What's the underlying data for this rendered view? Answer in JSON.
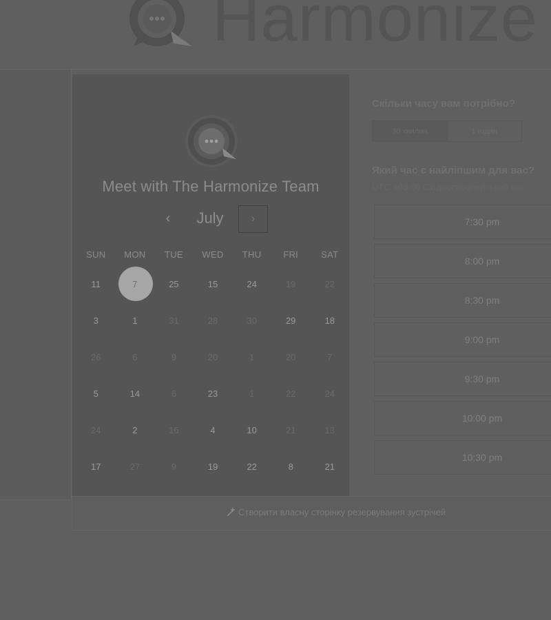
{
  "brand": {
    "name": "Harmonize",
    "logo_icon": "chat-bubble-q-logo"
  },
  "calendar": {
    "title": "Meet with The Harmonize Team",
    "month": "July",
    "prev_icon": "chevron-left-icon",
    "next_icon": "chevron-right-icon",
    "prev_glyph": "‹",
    "next_glyph": "›",
    "weekdays": [
      "SUN",
      "MON",
      "TUE",
      "WED",
      "THU",
      "FRI",
      "SAT"
    ],
    "weeks": [
      [
        {
          "label": "11",
          "available": true
        },
        {
          "label": "7",
          "available": true,
          "selected": true
        },
        {
          "label": "25",
          "available": true
        },
        {
          "label": "15",
          "available": true
        },
        {
          "label": "24",
          "available": true
        },
        {
          "label": "19",
          "available": false
        },
        {
          "label": "22",
          "available": false
        }
      ],
      [
        {
          "label": "3",
          "available": true
        },
        {
          "label": "1",
          "available": true
        },
        {
          "label": "31",
          "available": false
        },
        {
          "label": "28",
          "available": false
        },
        {
          "label": "30",
          "available": false
        },
        {
          "label": "29",
          "available": true
        },
        {
          "label": "18",
          "available": true
        }
      ],
      [
        {
          "label": "26",
          "available": false
        },
        {
          "label": "6",
          "available": false
        },
        {
          "label": "9",
          "available": false
        },
        {
          "label": "20",
          "available": false
        },
        {
          "label": "1",
          "available": false
        },
        {
          "label": "20",
          "available": false
        },
        {
          "label": "7",
          "available": false
        }
      ],
      [
        {
          "label": "5",
          "available": true
        },
        {
          "label": "14",
          "available": true
        },
        {
          "label": "6",
          "available": false
        },
        {
          "label": "23",
          "available": true
        },
        {
          "label": "1",
          "available": false
        },
        {
          "label": "22",
          "available": false
        },
        {
          "label": "24",
          "available": false
        }
      ],
      [
        {
          "label": "24",
          "available": false
        },
        {
          "label": "2",
          "available": true
        },
        {
          "label": "16",
          "available": false
        },
        {
          "label": "4",
          "available": true
        },
        {
          "label": "10",
          "available": true
        },
        {
          "label": "21",
          "available": false
        },
        {
          "label": "13",
          "available": false
        }
      ],
      [
        {
          "label": "17",
          "available": true
        },
        {
          "label": "27",
          "available": false
        },
        {
          "label": "9",
          "available": false
        },
        {
          "label": "19",
          "available": true
        },
        {
          "label": "22",
          "available": true
        },
        {
          "label": "8",
          "available": true
        },
        {
          "label": "21",
          "available": true
        }
      ]
    ]
  },
  "booking": {
    "duration_question": "Скільки часу вам потрібно?",
    "durations": [
      "30 хвилин",
      "1 годин"
    ],
    "time_question": "Який час є найліпшим для вас?",
    "timezone": "UTC +03:00 Східноєвропейський час",
    "time_slots": [
      "7:30 pm",
      "8:00 pm",
      "8:30 pm",
      "9:00 pm",
      "9:30 pm",
      "10:00 pm",
      "10:30 pm"
    ]
  },
  "footer": {
    "create_link": "Створити власну сторінку резервування зустрічей",
    "create_icon": "magic-wand-icon"
  }
}
